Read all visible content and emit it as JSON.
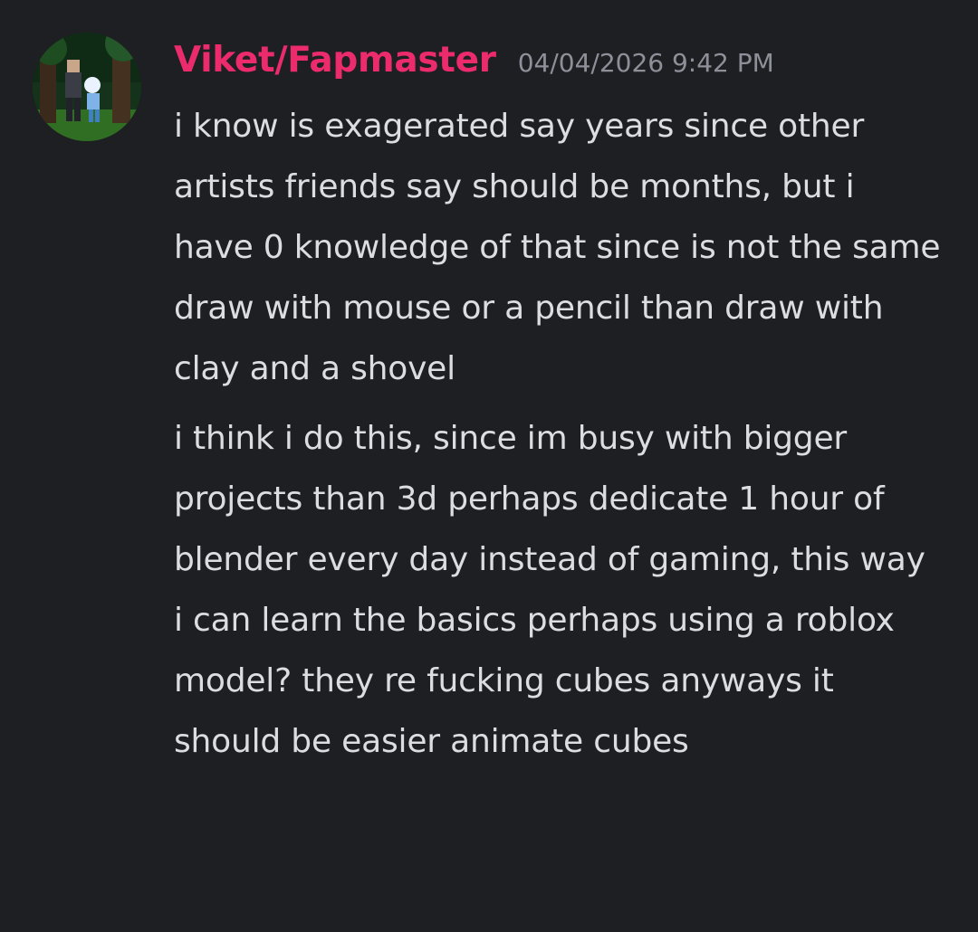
{
  "message": {
    "author": {
      "name": "Viket/Fapmaster",
      "name_color": "#ec2b6d",
      "avatar_icon": "user-avatar"
    },
    "timestamp": "04/04/2026 9:42 PM",
    "paragraphs": [
      "i know is exagerated say years since other artists friends say should be months, but i have 0 knowledge of that since is not the same draw with mouse or a pencil than draw with clay and a shovel",
      "i think i do this, since im busy with bigger projects than 3d perhaps dedicate 1 hour of blender every day instead of gaming, this way i can learn the basics perhaps using a roblox model? they re fucking cubes anyways it should be easier animate cubes"
    ]
  },
  "colors": {
    "background": "#1e1f23",
    "text": "#dcdde1",
    "timestamp": "#8e9099"
  }
}
